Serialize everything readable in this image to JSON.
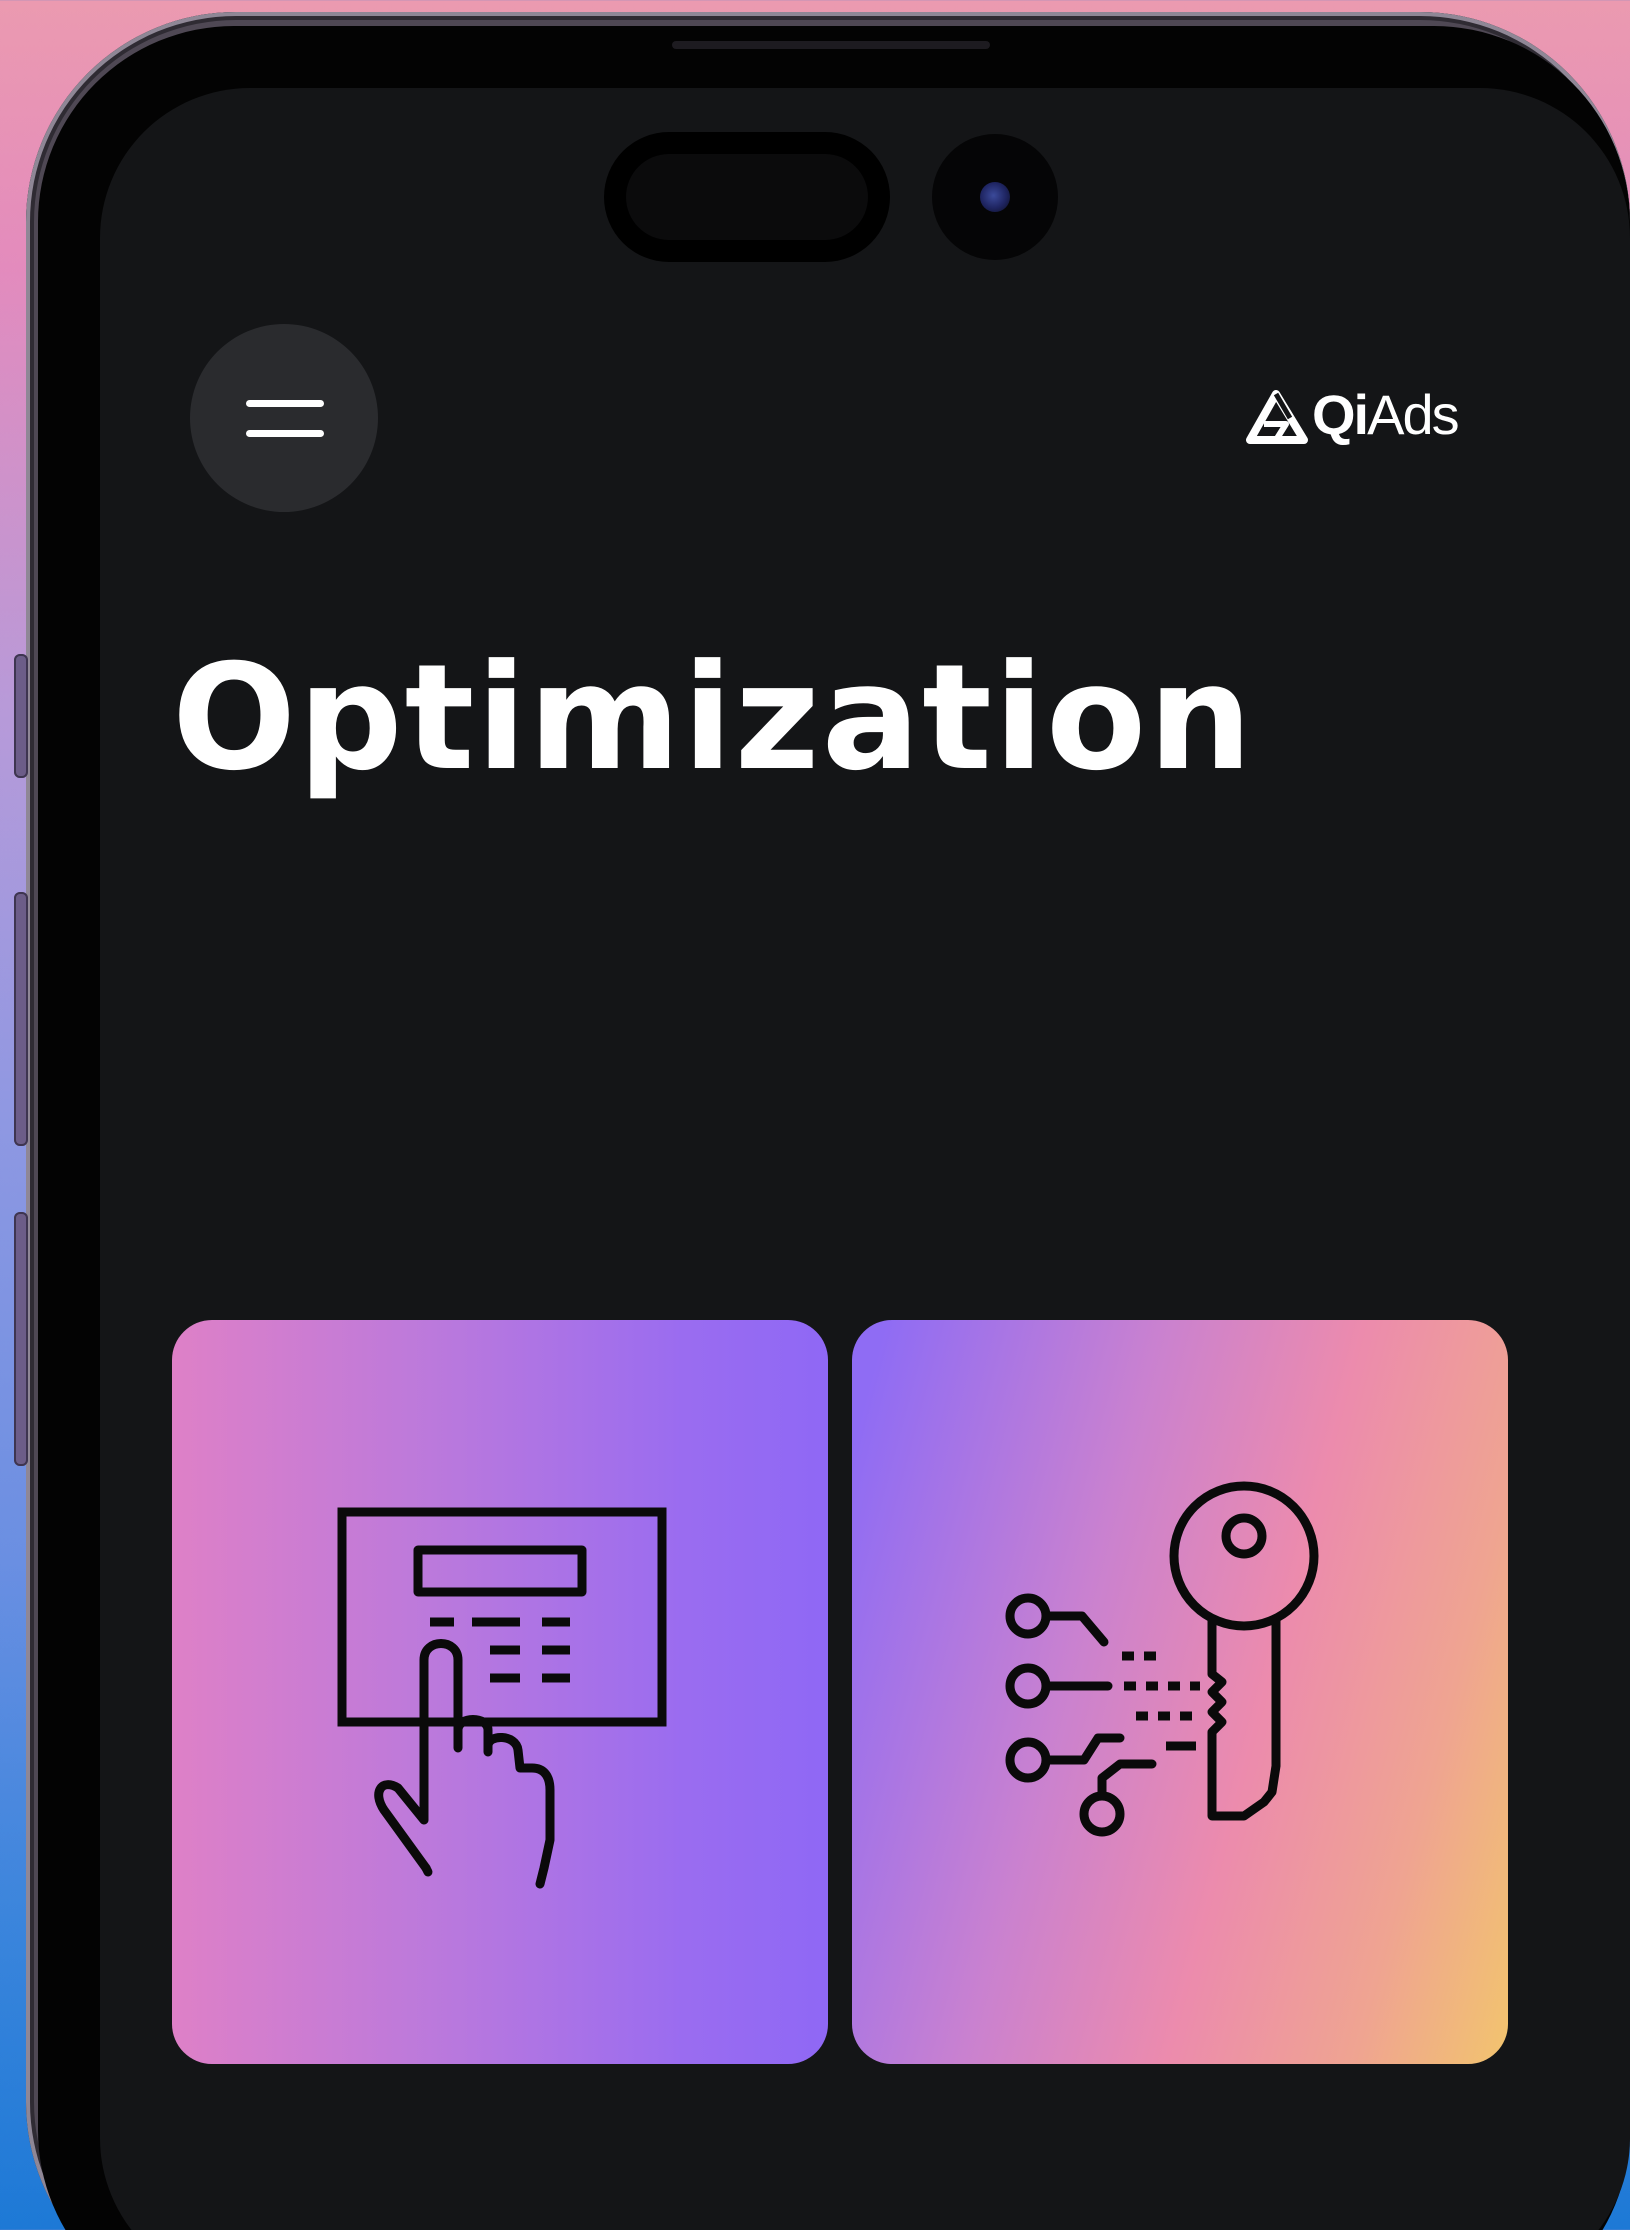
{
  "header": {
    "menu_icon": "hamburger-menu-icon",
    "logo_icon": "qiads-triangle-logo-icon",
    "logo_text_bold": "Qi",
    "logo_text_light": "Ads"
  },
  "page": {
    "title": "Optimization"
  },
  "cards": [
    {
      "icon": "keypad-hand-icon"
    },
    {
      "icon": "digital-key-icon"
    }
  ],
  "colors": {
    "screen_background": "#141517",
    "menu_button_background": "#2a2b2e",
    "text": "#ffffff",
    "icon_stroke": "#0a0a0a",
    "card_left_gradient": [
      "#de80c7",
      "#8f68f5"
    ],
    "card_right_gradient": [
      "#8f6cf4",
      "#ec8bad",
      "#f2c46e"
    ]
  }
}
